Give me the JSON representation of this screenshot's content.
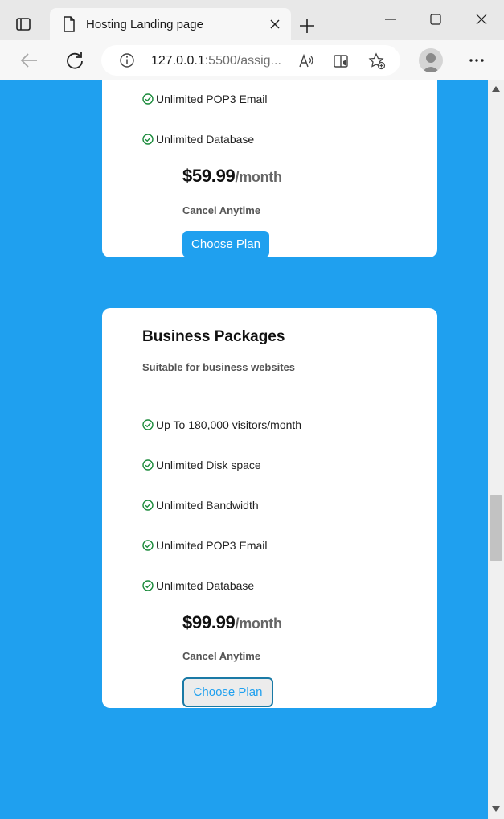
{
  "browser": {
    "tab_title": "Hosting Landing page",
    "url_host": "127.0.0.1",
    "url_rest": ":5500/assig..."
  },
  "plans": [
    {
      "features": [
        "Unlimited POP3 Email",
        "Unlimited Database"
      ],
      "price": "$59.99",
      "period": "/month",
      "cancel": "Cancel Anytime",
      "cta": "Choose Plan"
    },
    {
      "title": "Business Packages",
      "subtitle": "Suitable for business websites",
      "features": [
        "Up To 180,000 visitors/month",
        "Unlimited Disk space",
        "Unlimited Bandwidth",
        "Unlimited POP3 Email",
        "Unlimited Database"
      ],
      "price": "$99.99",
      "period": "/month",
      "cancel": "Cancel Anytime",
      "cta": "Choose Plan"
    }
  ],
  "colors": {
    "page_background": "#1fa0ef",
    "accent": "#1fa0ef",
    "check": "#1a8a3a"
  }
}
